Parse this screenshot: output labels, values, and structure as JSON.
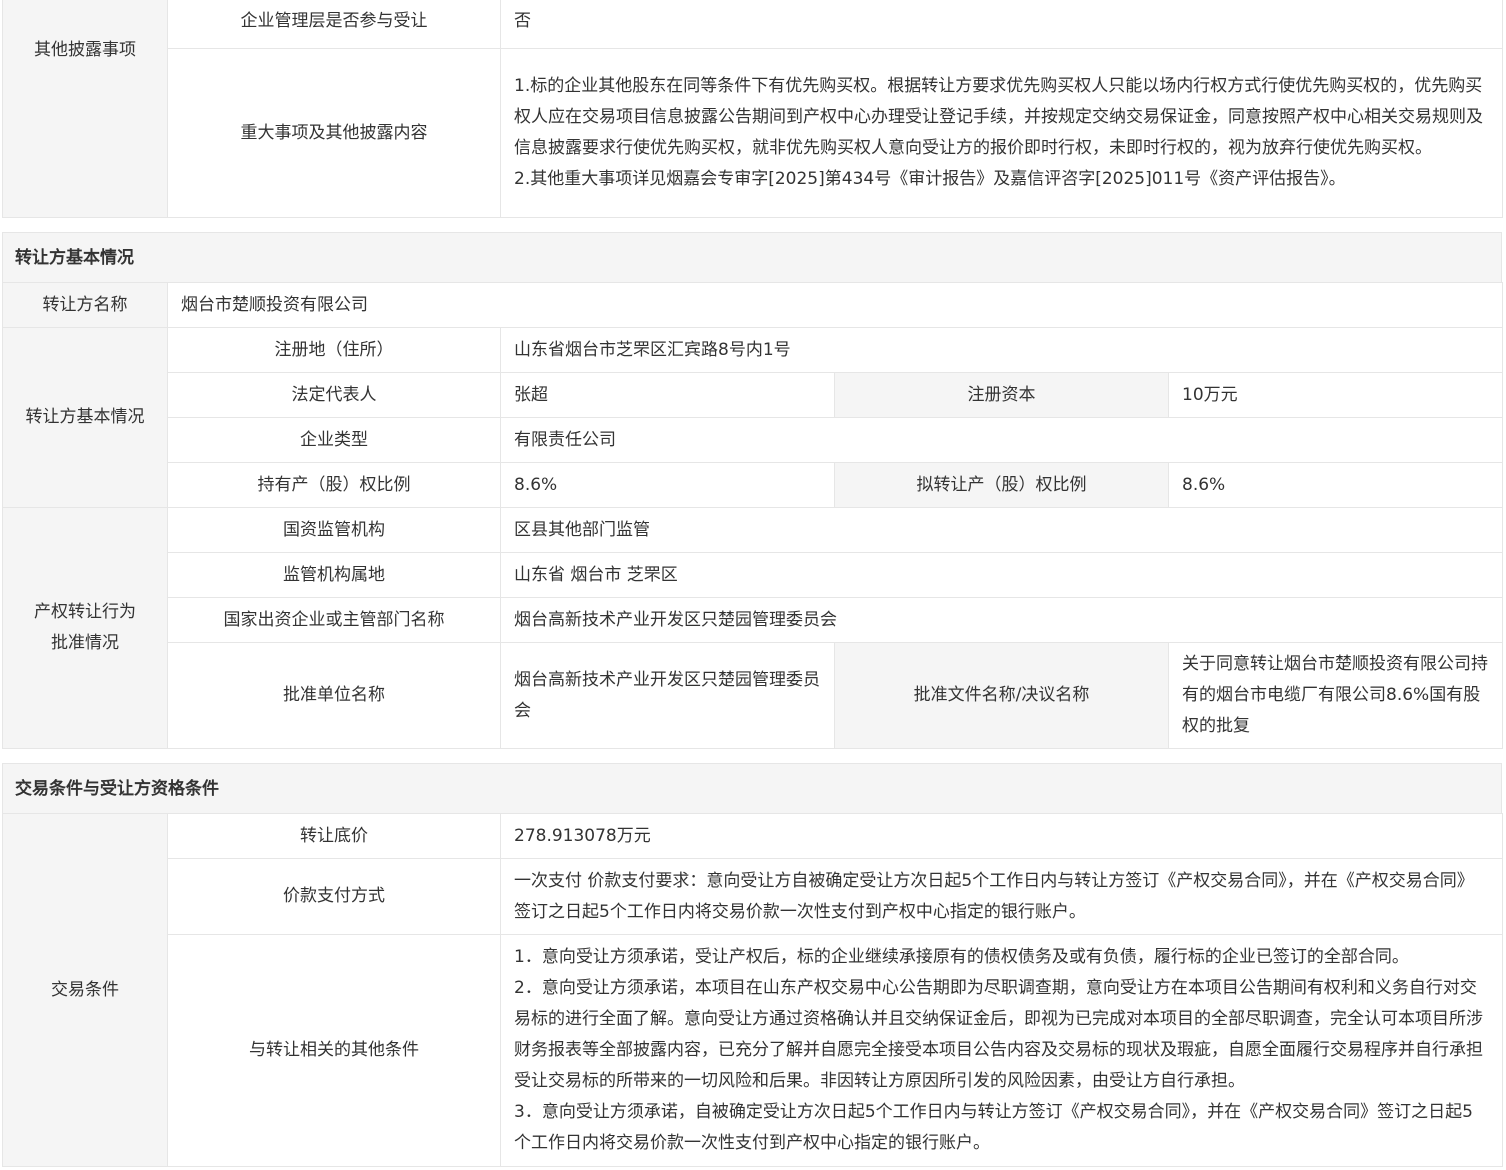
{
  "other_disclosure": {
    "label": "其他披露事项",
    "rows": [
      {
        "label": "企业管理层是否参与受让",
        "value": "否"
      },
      {
        "label": "重大事项及其他披露内容",
        "paragraphs": [
          "1.标的企业其他股东在同等条件下有优先购买权。根据转让方要求优先购买权人只能以场内行权方式行使优先购买权的，优先购买权人应在交易项目信息披露公告期间到产权中心办理受让登记手续，并按规定交纳交易保证金，同意按照产权中心相关交易规则及信息披露要求行使优先购买权，就非优先购买权人意向受让方的报价即时行权，未即时行权的，视为放弃行使优先购买权。",
          "2.其他重大事项详见烟嘉会专审字[2025]第434号《审计报告》及嘉信评咨字[2025]011号《资产评估报告》。"
        ]
      }
    ]
  },
  "transferor_section": {
    "title": "转让方基本情况",
    "name_label": "转让方名称",
    "name_value": "烟台市楚顺投资有限公司",
    "basic": {
      "label": "转让方基本情况",
      "address_label": "注册地（住所）",
      "address_value": "山东省烟台市芝罘区汇宾路8号内1号",
      "legal_rep_label": "法定代表人",
      "legal_rep_value": "张超",
      "capital_label": "注册资本",
      "capital_value": "10万元",
      "type_label": "企业类型",
      "type_value": "有限责任公司",
      "held_ratio_label": "持有产（股）权比例",
      "held_ratio_value": "8.6%",
      "transfer_ratio_label": "拟转让产（股）权比例",
      "transfer_ratio_value": "8.6%"
    },
    "approval": {
      "label_line1": "产权转让行为",
      "label_line2": "批准情况",
      "regulator_label": "国资监管机构",
      "regulator_value": "区县其他部门监管",
      "location_label": "监管机构属地",
      "location_value": "山东省 烟台市 芝罘区",
      "dept_label": "国家出资企业或主管部门名称",
      "dept_value": "烟台高新技术产业开发区只楚园管理委员会",
      "approver_label": "批准单位名称",
      "approver_value": "烟台高新技术产业开发区只楚园管理委员会",
      "doc_label": "批准文件名称/决议名称",
      "doc_value": "关于同意转让烟台市楚顺投资有限公司持有的烟台市电缆厂有限公司8.6%国有股权的批复"
    }
  },
  "trade_section": {
    "title": "交易条件与受让方资格条件",
    "label": "交易条件",
    "price_label": "转让底价",
    "price_value": "278.913078万元",
    "payment_label": "价款支付方式",
    "payment_value": "一次支付 价款支付要求：意向受让方自被确定受让方次日起5个工作日内与转让方签订《产权交易合同》，并在《产权交易合同》签订之日起5个工作日内将交易价款一次性支付到产权中心指定的银行账户。",
    "other_label": "与转让相关的其他条件",
    "other_paragraphs": [
      "1．意向受让方须承诺，受让产权后，标的企业继续承接原有的债权债务及或有负债，履行标的企业已签订的全部合同。",
      "2．意向受让方须承诺，本项目在山东产权交易中心公告期即为尽职调查期，意向受让方在本项目公告期间有权利和义务自行对交易标的进行全面了解。意向受让方通过资格确认并且交纳保证金后，即视为已完成对本项目的全部尽职调查，完全认可本项目所涉财务报表等全部披露内容，已充分了解并自愿完全接受本项目公告内容及交易标的现状及瑕疵，自愿全面履行交易程序并自行承担受让交易标的所带来的一切风险和后果。非因转让方原因所引发的风险因素，由受让方自行承担。",
      "3．意向受让方须承诺，自被确定受让方次日起5个工作日内与转让方签订《产权交易合同》，并在《产权交易合同》签订之日起5个工作日内将交易价款一次性支付到产权中心指定的银行账户。"
    ]
  }
}
